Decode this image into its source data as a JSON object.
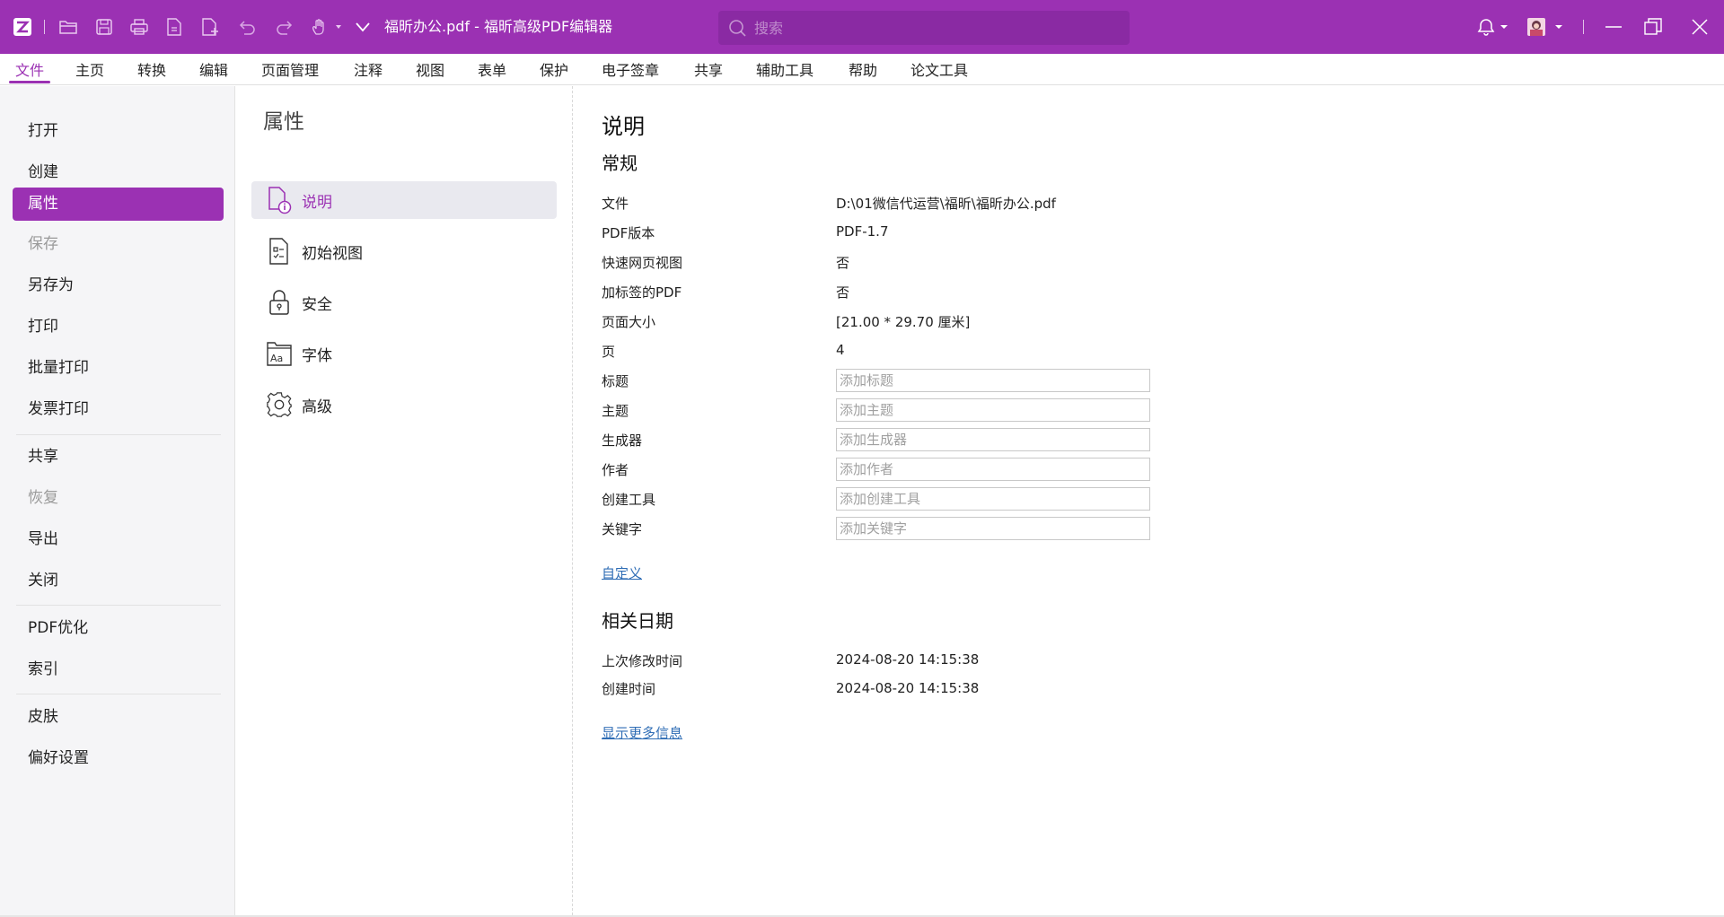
{
  "titlebar": {
    "title": "福昕办公.pdf - 福昕高级PDF编辑器",
    "search_placeholder": "搜索",
    "brand_color": "#9b31b3",
    "icons": [
      "app-logo-icon",
      "open-folder-icon",
      "save-icon",
      "print-icon",
      "file-icon",
      "new-file-icon",
      "undo-icon",
      "redo-icon",
      "hand-tool-icon",
      "customize-dropdown-icon",
      "bell-icon",
      "avatar",
      "minimize-icon",
      "restore-icon",
      "close-icon"
    ]
  },
  "menu": {
    "items": [
      "文件",
      "主页",
      "转换",
      "编辑",
      "页面管理",
      "注释",
      "视图",
      "表单",
      "保护",
      "电子签章",
      "共享",
      "辅助工具",
      "帮助",
      "论文工具"
    ],
    "active": "文件"
  },
  "leftnav": {
    "items": [
      {
        "label": "打开",
        "state": "normal"
      },
      {
        "label": "创建",
        "state": "normal"
      },
      {
        "label": "属性",
        "state": "active"
      },
      {
        "label": "保存",
        "state": "disabled"
      },
      {
        "label": "另存为",
        "state": "normal"
      },
      {
        "label": "打印",
        "state": "normal"
      },
      {
        "label": "批量打印",
        "state": "normal"
      },
      {
        "label": "发票打印",
        "state": "normal"
      },
      {
        "label": "共享",
        "state": "normal"
      },
      {
        "label": "恢复",
        "state": "disabled"
      },
      {
        "label": "导出",
        "state": "normal"
      },
      {
        "label": "关闭",
        "state": "normal"
      },
      {
        "label": "PDF优化",
        "state": "normal"
      },
      {
        "label": "索引",
        "state": "normal"
      },
      {
        "label": "皮肤",
        "state": "normal"
      },
      {
        "label": "偏好设置",
        "state": "normal"
      }
    ]
  },
  "properties_panel": {
    "title": "属性",
    "items": [
      {
        "label": "说明",
        "icon": "document-info-icon",
        "active": true
      },
      {
        "label": "初始视图",
        "icon": "initial-view-icon",
        "active": false
      },
      {
        "label": "安全",
        "icon": "lock-icon",
        "active": false
      },
      {
        "label": "字体",
        "icon": "font-icon",
        "active": false
      },
      {
        "label": "高级",
        "icon": "gear-icon",
        "active": false
      }
    ]
  },
  "details": {
    "heading": "说明",
    "general_heading": "常规",
    "info_rows": [
      {
        "label": "文件",
        "value": "D:\\01微信代运营\\福昕\\福昕办公.pdf"
      },
      {
        "label": "PDF版本",
        "value": "PDF-1.7"
      },
      {
        "label": "快速网页视图",
        "value": "否"
      },
      {
        "label": "加标签的PDF",
        "value": "否"
      },
      {
        "label": "页面大小",
        "value": "[21.00 * 29.70 厘米]"
      },
      {
        "label": "页",
        "value": "4"
      }
    ],
    "input_rows": [
      {
        "label": "标题",
        "value": "",
        "placeholder": "添加标题"
      },
      {
        "label": "主题",
        "value": "",
        "placeholder": "添加主题"
      },
      {
        "label": "生成器",
        "value": "",
        "placeholder": "添加生成器"
      },
      {
        "label": "作者",
        "value": "",
        "placeholder": "添加作者"
      },
      {
        "label": "创建工具",
        "value": "",
        "placeholder": "添加创建工具"
      },
      {
        "label": "关键字",
        "value": "",
        "placeholder": "添加关键字"
      }
    ],
    "custom_link": "自定义",
    "dates_heading": "相关日期",
    "date_rows": [
      {
        "label": "上次修改时间",
        "value": "2024-08-20 14:15:38"
      },
      {
        "label": "创建时间",
        "value": "2024-08-20 14:15:38"
      }
    ],
    "more_info_link": "显示更多信息"
  }
}
